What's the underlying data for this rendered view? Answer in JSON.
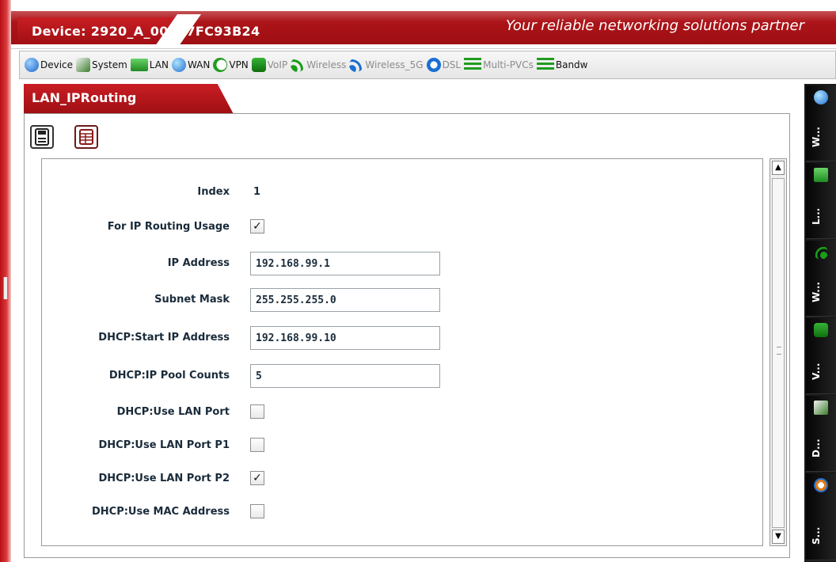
{
  "header": {
    "device_title": "Device: 2920_A_00507FC93B24",
    "slogan": "Your reliable networking solutions partner"
  },
  "toolbar": {
    "items": [
      {
        "label": "Device",
        "icon": "globe-icon",
        "enabled": true
      },
      {
        "label": "System",
        "icon": "system-icon",
        "enabled": true
      },
      {
        "label": "LAN",
        "icon": "monitor-icon",
        "enabled": true
      },
      {
        "label": "WAN",
        "icon": "globe-icon",
        "enabled": true
      },
      {
        "label": "VPN",
        "icon": "vpn-icon",
        "enabled": true
      },
      {
        "label": "VoIP",
        "icon": "phone-icon",
        "enabled": false
      },
      {
        "label": "Wireless",
        "icon": "wifi-icon",
        "enabled": false
      },
      {
        "label": "Wireless_5G",
        "icon": "wifi-icon",
        "enabled": false
      },
      {
        "label": "DSL",
        "icon": "dsl-icon",
        "enabled": false
      },
      {
        "label": "Multi-PVCs",
        "icon": "pvc-icon",
        "enabled": false
      },
      {
        "label": "Bandw",
        "icon": "bandwidth-icon",
        "enabled": true
      }
    ]
  },
  "page": {
    "tab_title": "LAN_IPRouting"
  },
  "form": {
    "index": {
      "label": "Index",
      "value": "1"
    },
    "for_ip_routing_usage": {
      "label": "For IP Routing Usage",
      "checked": true
    },
    "ip_address": {
      "label": "IP Address",
      "value": "192.168.99.1"
    },
    "subnet_mask": {
      "label": "Subnet Mask",
      "value": "255.255.255.0"
    },
    "dhcp_start_ip": {
      "label": "DHCP:Start IP Address",
      "value": "192.168.99.10"
    },
    "dhcp_pool_counts": {
      "label": "DHCP:IP Pool Counts",
      "value": "5"
    },
    "dhcp_use_lan_port": {
      "label": "DHCP:Use LAN Port",
      "checked": false
    },
    "dhcp_use_lan_port_p1": {
      "label": "DHCP:Use LAN Port P1",
      "checked": false
    },
    "dhcp_use_lan_port_p2": {
      "label": "DHCP:Use LAN Port P2",
      "checked": true
    },
    "dhcp_use_mac": {
      "label": "DHCP:Use MAC Address",
      "checked": false
    }
  },
  "rail": {
    "items": [
      {
        "label": "W...",
        "icon": "globe-icon"
      },
      {
        "label": "L...",
        "icon": "monitor-icon"
      },
      {
        "label": "W...",
        "icon": "wifi-icon"
      },
      {
        "label": "V...",
        "icon": "phone-icon"
      },
      {
        "label": "D...",
        "icon": "system-icon"
      },
      {
        "label": "S...",
        "icon": "settings-icon"
      }
    ]
  },
  "colors": {
    "brand_red": "#b3161b",
    "label_text": "#1a2b3a"
  }
}
